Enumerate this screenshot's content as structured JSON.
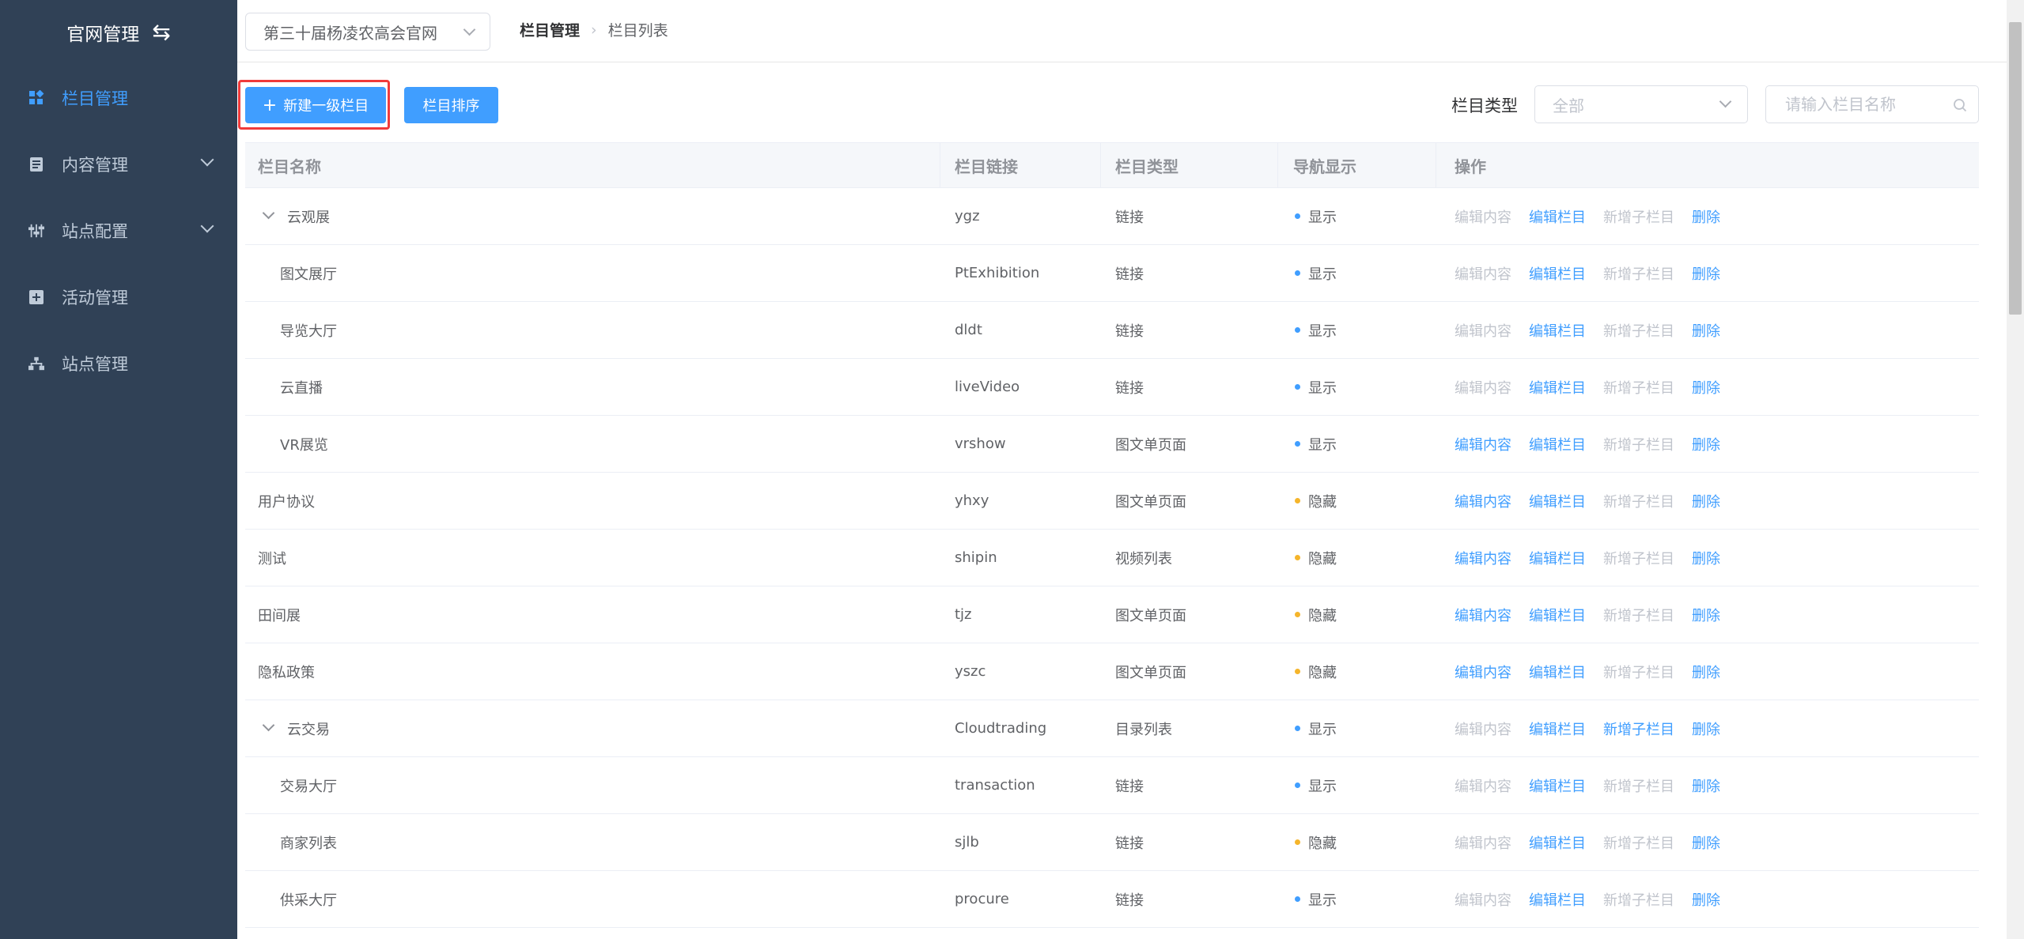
{
  "sidebar": {
    "title": "官网管理",
    "items": [
      {
        "label": "栏目管理",
        "icon": "grid-icon",
        "active": true,
        "expandable": false
      },
      {
        "label": "内容管理",
        "icon": "document-icon",
        "active": false,
        "expandable": true
      },
      {
        "label": "站点配置",
        "icon": "sliders-icon",
        "active": false,
        "expandable": true
      },
      {
        "label": "活动管理",
        "icon": "plus-square-icon",
        "active": false,
        "expandable": false
      },
      {
        "label": "站点管理",
        "icon": "sitemap-icon",
        "active": false,
        "expandable": false
      }
    ]
  },
  "header": {
    "site_select_value": "第三十届杨凌农高会官网",
    "breadcrumb": [
      "栏目管理",
      "栏目列表"
    ]
  },
  "toolbar": {
    "new_button": "新建一级栏目",
    "sort_button": "栏目排序",
    "type_label": "栏目类型",
    "type_select_value": "全部",
    "search_placeholder": "请输入栏目名称"
  },
  "table": {
    "columns": [
      "栏目名称",
      "栏目链接",
      "栏目类型",
      "导航显示",
      "操作"
    ],
    "ops_labels": [
      "编辑内容",
      "编辑栏目",
      "新增子栏目",
      "删除"
    ],
    "rows": [
      {
        "name": "云观展",
        "link": "ygz",
        "type": "链接",
        "nav": "显示",
        "level": 0,
        "expanded": true,
        "ops_enabled": [
          false,
          true,
          false,
          true
        ]
      },
      {
        "name": "图文展厅",
        "link": "PtExhibition",
        "type": "链接",
        "nav": "显示",
        "level": 1,
        "ops_enabled": [
          false,
          true,
          false,
          true
        ]
      },
      {
        "name": "导览大厅",
        "link": "dldt",
        "type": "链接",
        "nav": "显示",
        "level": 1,
        "ops_enabled": [
          false,
          true,
          false,
          true
        ]
      },
      {
        "name": "云直播",
        "link": "liveVideo",
        "type": "链接",
        "nav": "显示",
        "level": 1,
        "ops_enabled": [
          false,
          true,
          false,
          true
        ]
      },
      {
        "name": "VR展览",
        "link": "vrshow",
        "type": "图文单页面",
        "nav": "显示",
        "level": 1,
        "ops_enabled": [
          true,
          true,
          false,
          true
        ]
      },
      {
        "name": "用户协议",
        "link": "yhxy",
        "type": "图文单页面",
        "nav": "隐藏",
        "level": 0,
        "ops_enabled": [
          true,
          true,
          false,
          true
        ]
      },
      {
        "name": "测试",
        "link": "shipin",
        "type": "视频列表",
        "nav": "隐藏",
        "level": 0,
        "ops_enabled": [
          true,
          true,
          false,
          true
        ]
      },
      {
        "name": "田间展",
        "link": "tjz",
        "type": "图文单页面",
        "nav": "隐藏",
        "level": 0,
        "ops_enabled": [
          true,
          true,
          false,
          true
        ]
      },
      {
        "name": "隐私政策",
        "link": "yszc",
        "type": "图文单页面",
        "nav": "隐藏",
        "level": 0,
        "ops_enabled": [
          true,
          true,
          false,
          true
        ]
      },
      {
        "name": "云交易",
        "link": "Cloudtrading",
        "type": "目录列表",
        "nav": "显示",
        "level": 0,
        "expanded": true,
        "ops_enabled": [
          false,
          true,
          true,
          true
        ]
      },
      {
        "name": "交易大厅",
        "link": "transaction",
        "type": "链接",
        "nav": "显示",
        "level": 1,
        "ops_enabled": [
          false,
          true,
          false,
          true
        ]
      },
      {
        "name": "商家列表",
        "link": "sjlb",
        "type": "链接",
        "nav": "隐藏",
        "level": 1,
        "ops_enabled": [
          false,
          true,
          false,
          true
        ]
      },
      {
        "name": "供采大厅",
        "link": "procure",
        "type": "链接",
        "nav": "显示",
        "level": 1,
        "ops_enabled": [
          false,
          true,
          false,
          true
        ]
      }
    ]
  },
  "colors": {
    "sidebar_bg": "#304156",
    "accent": "#409eff",
    "show_dot": "#409eff",
    "hide_dot": "#f5b52b",
    "highlight": "#f03b3b"
  }
}
